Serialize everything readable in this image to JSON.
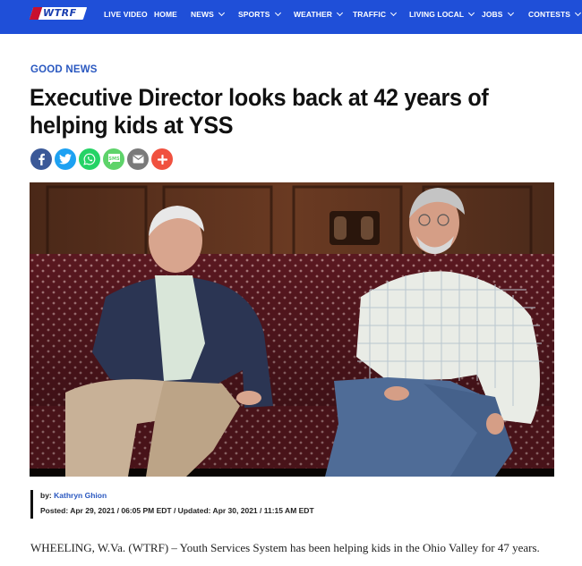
{
  "nav": {
    "logo_text": "WTRF",
    "items": [
      {
        "label": "LIVE VIDEO",
        "has_dropdown": false
      },
      {
        "label": "HOME",
        "has_dropdown": false
      },
      {
        "label": "NEWS",
        "has_dropdown": true
      },
      {
        "label": "SPORTS",
        "has_dropdown": true
      },
      {
        "label": "WEATHER",
        "has_dropdown": true
      },
      {
        "label": "TRAFFIC",
        "has_dropdown": true
      },
      {
        "label": "LIVING LOCAL",
        "has_dropdown": true
      },
      {
        "label": "JOBS",
        "has_dropdown": true
      },
      {
        "label": "CONTESTS",
        "has_dropdown": true
      }
    ]
  },
  "article": {
    "category": "GOOD NEWS",
    "headline": "Executive Director looks back at 42 years of helping kids at YSS",
    "by_label": "by:",
    "author": "Kathryn Ghion",
    "posted": "Posted: Apr 29, 2021 / 06:05 PM EDT / Updated: Apr 30, 2021 / 11:15 AM EDT",
    "lede": "WHEELING, W.Va. (WTRF) – Youth Services System has been helping kids in the Ohio Valley for 47 years."
  },
  "share": [
    {
      "name": "facebook-icon",
      "glyph": "f",
      "color": "#3b5998"
    },
    {
      "name": "twitter-icon",
      "glyph": "t",
      "color": "#1da1f2"
    },
    {
      "name": "whatsapp-icon",
      "glyph": "w",
      "color": "#25d366"
    },
    {
      "name": "sms-icon",
      "glyph": "sms",
      "color": "#5ed36a"
    },
    {
      "name": "email-icon",
      "glyph": "mail",
      "color": "#7a7a7a"
    },
    {
      "name": "more-share-icon",
      "glyph": "+",
      "color": "#f0513f"
    }
  ],
  "colors": {
    "nav_bg": "#1f4fd8",
    "category": "#2a58c0",
    "author_link": "#2a58c0"
  }
}
